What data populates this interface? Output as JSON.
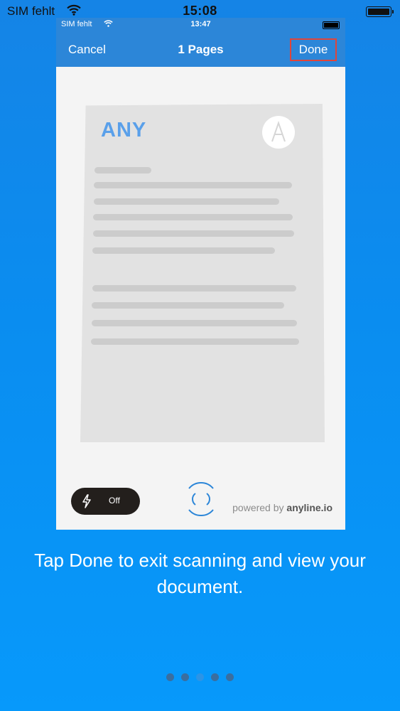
{
  "device_status": {
    "carrier": "SIM fehlt",
    "time": "15:08"
  },
  "screenshot": {
    "status": {
      "carrier": "SIM fehlt",
      "time": "13:47"
    },
    "navbar": {
      "cancel_label": "Cancel",
      "title": "1 Pages",
      "done_label": "Done"
    },
    "document": {
      "brand": "ANY"
    },
    "flash_toggle": {
      "label": "Off"
    },
    "powered_by": {
      "prefix": "powered by ",
      "brand": "anyline.io"
    }
  },
  "caption": "Tap Done to exit scanning and view your document.",
  "pager": {
    "count": 5,
    "active_index": 2
  },
  "colors": {
    "accent": "#2c86d8",
    "highlight": "#e0453a",
    "background": "#0a8df0"
  }
}
